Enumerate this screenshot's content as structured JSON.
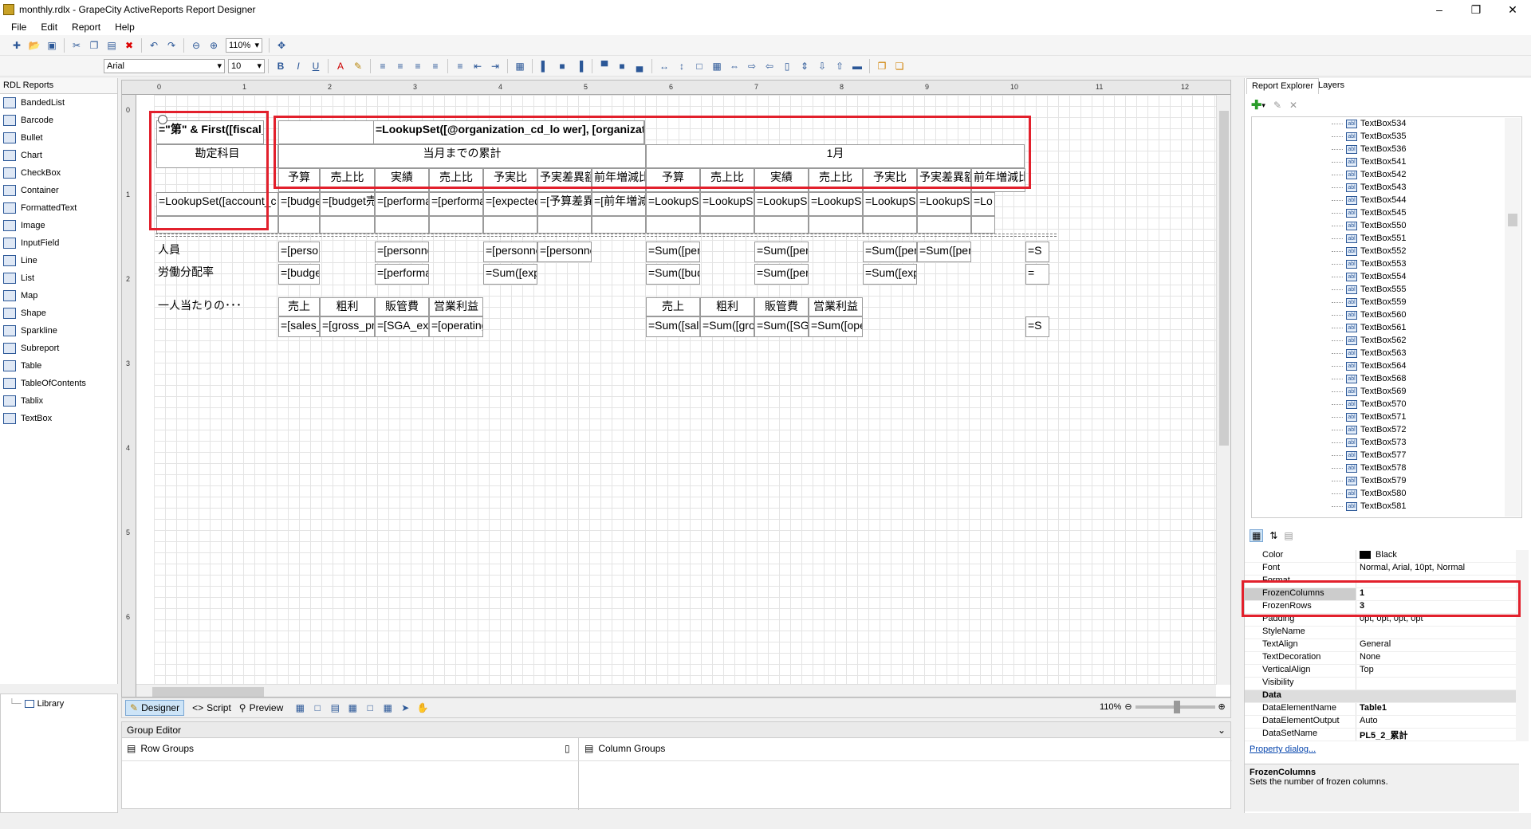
{
  "window": {
    "title": "monthly.rdlx - GrapeCity ActiveReports Report Designer"
  },
  "menu": [
    "File",
    "Edit",
    "Report",
    "Help"
  ],
  "toolbar": {
    "zoom": "110%",
    "font": "Arial",
    "size": "10"
  },
  "toolbox": {
    "header": "RDL Reports",
    "items": [
      "BandedList",
      "Barcode",
      "Bullet",
      "Chart",
      "CheckBox",
      "Container",
      "FormattedText",
      "Image",
      "InputField",
      "Line",
      "List",
      "Map",
      "Shape",
      "Sparkline",
      "Subreport",
      "Table",
      "TableOfContents",
      "Tablix",
      "TextBox"
    ]
  },
  "library": {
    "label": "Library"
  },
  "ruler": {
    "h": [
      "0",
      "1",
      "2",
      "3",
      "4",
      "5",
      "6",
      "7",
      "8",
      "9",
      "10",
      "11",
      "12"
    ],
    "v": [
      "0",
      "1",
      "2",
      "3",
      "4",
      "5",
      "6"
    ]
  },
  "report": {
    "r1": {
      "a": "=\"第\" & First([fiscal_period], \"mSystem\") & \"期損益推移表\"",
      "b": "=LookupSet([@organization_cd_lo wer], [organization_cd]"
    },
    "r2": {
      "a": "勘定科目",
      "b": "当月までの累計",
      "c": "1月"
    },
    "r3": [
      "予算",
      "売上比",
      "実績",
      "売上比",
      "予実比",
      "予実差異額",
      "前年増減比",
      "予算",
      "売上比",
      "実績",
      "売上比",
      "予実比",
      "予実差異額",
      "前年増減比"
    ],
    "r4a": "=LookupSet([account_c d], [account_cd]",
    "r4": [
      "=[budget]",
      "=[budget売上比]",
      "=[performance]",
      "=[performance売上比]",
      "=[expected actual_rati",
      "=[予算差異額]",
      "=[前年増減比]",
      "=LookupSe t([account",
      "=LookupSe t([account",
      "=LookupSe t([account",
      "=LookupSe t([account",
      "=LookupSe t([account",
      "=LookupSe t([account",
      "=Lo"
    ],
    "s1": {
      "label": "人員",
      "c1": "=[personnel budget]",
      "c3": "=[personnel achievem",
      "c5": "=[personnel preliminar",
      "c6": "=[personnel preliminar",
      "c8": "=Sum([pers onnel_budg",
      "c10": "=Sum([pers onnel_achi",
      "c12": "=Sum([pers onnel_preli",
      "c13": "=Sum([pers onnel_preli",
      "c15": "=S"
    },
    "s2": {
      "label": "労働分配率",
      "c1": "=[budget]",
      "c3": "=[performance]",
      "c5": "=Sum([exp ected_actu",
      "c8": "=Sum([bud get])",
      "c10": "=Sum([perf ormance])",
      "c12": "=Sum([exp ected_actu",
      "c15": "="
    },
    "s3": {
      "label": "一人当たりの･･･",
      "h": [
        "売上",
        "粗利",
        "販管費",
        "営業利益"
      ],
      "h2": [
        "売上",
        "粗利",
        "販管費",
        "営業利益"
      ],
      "v": [
        "=[sales_per person]",
        "=[gross_pr ofit_per_pe",
        "=[SGA_exp enses_per",
        "=[operating _income_p"
      ],
      "v2": [
        "=Sum([sale s_per_pers",
        "=Sum([gros s_profit_pe",
        "=Sum([SG A_expense",
        "=Sum([oper ating_inco"
      ],
      "v15": "=S"
    }
  },
  "bottom": {
    "designer": "Designer",
    "script": "Script",
    "preview": "Preview",
    "zoom": "110%"
  },
  "groupeditor": {
    "title": "Group Editor",
    "row": "Row Groups",
    "col": "Column Groups"
  },
  "explorer": {
    "tab1": "Report Explorer",
    "tab2": "Layers",
    "nodes": [
      "TextBox534",
      "TextBox535",
      "TextBox536",
      "TextBox541",
      "TextBox542",
      "TextBox543",
      "TextBox544",
      "TextBox545",
      "TextBox550",
      "TextBox551",
      "TextBox552",
      "TextBox553",
      "TextBox554",
      "TextBox555",
      "TextBox559",
      "TextBox560",
      "TextBox561",
      "TextBox562",
      "TextBox563",
      "TextBox564",
      "TextBox568",
      "TextBox569",
      "TextBox570",
      "TextBox571",
      "TextBox572",
      "TextBox573",
      "TextBox577",
      "TextBox578",
      "TextBox579",
      "TextBox580",
      "TextBox581"
    ]
  },
  "props": [
    {
      "n": "Color",
      "v": "Black"
    },
    {
      "n": "Font",
      "v": "Normal, Arial, 10pt, Normal"
    },
    {
      "n": "Format",
      "v": ""
    },
    {
      "n": "FrozenColumns",
      "v": "1",
      "sel": true
    },
    {
      "n": "FrozenRows",
      "v": "3"
    },
    {
      "n": "Padding",
      "v": "0pt, 0pt, 0pt, 0pt"
    },
    {
      "n": "StyleName",
      "v": ""
    },
    {
      "n": "TextAlign",
      "v": "General"
    },
    {
      "n": "TextDecoration",
      "v": "None"
    },
    {
      "n": "VerticalAlign",
      "v": "Top"
    },
    {
      "n": "Visibility",
      "v": ""
    },
    {
      "n": "Data",
      "v": "",
      "cat": true
    },
    {
      "n": "DataElementName",
      "v": "Table1"
    },
    {
      "n": "DataElementOutput",
      "v": "Auto"
    },
    {
      "n": "DataSetName",
      "v": "PL5_2_累計"
    }
  ],
  "propdialog": "Property dialog...",
  "desc": {
    "title": "FrozenColumns",
    "text": "Sets the number of frozen columns."
  },
  "colors": {
    "highlight": "#e2202c"
  }
}
